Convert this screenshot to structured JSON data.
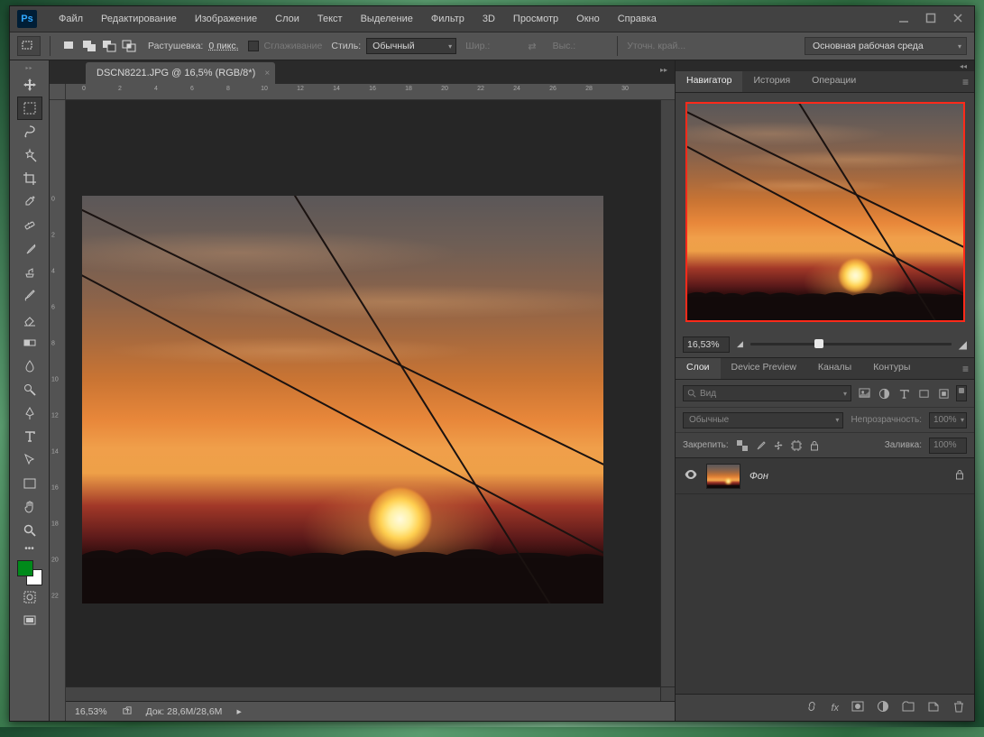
{
  "menuBar": [
    "Файл",
    "Редактирование",
    "Изображение",
    "Слои",
    "Текст",
    "Выделение",
    "Фильтр",
    "3D",
    "Просмотр",
    "Окно",
    "Справка"
  ],
  "optionsBar": {
    "featherLabel": "Растушевка:",
    "featherValue": "0 пикс.",
    "antiAliasLabel": "Сглаживание",
    "styleLabel": "Стиль:",
    "styleValue": "Обычный",
    "widthLabel": "Шир.:",
    "heightLabel": "Выс.:",
    "refineEdge": "Уточн. край...",
    "workspace": "Основная рабочая среда"
  },
  "documentTab": "DSCN8221.JPG @ 16,5% (RGB/8*)",
  "hRuler": [
    "0",
    "2",
    "4",
    "6",
    "8",
    "10",
    "12",
    "14",
    "16",
    "18",
    "20",
    "22",
    "24",
    "26",
    "28",
    "30"
  ],
  "vRuler": [
    "0",
    "2",
    "4",
    "6",
    "8",
    "10",
    "12",
    "14",
    "16",
    "18",
    "20",
    "22"
  ],
  "statusBar": {
    "zoom": "16,53%",
    "docSizeLabel": "Док:",
    "docSize": "28,6M/28,6M"
  },
  "navigator": {
    "tabs": [
      "Навигатор",
      "История",
      "Операции"
    ],
    "zoom": "16,53%"
  },
  "layersPanel": {
    "tabs": [
      "Слои",
      "Device Preview",
      "Каналы",
      "Контуры"
    ],
    "searchPlaceholder": "Вид",
    "blendMode": "Обычные",
    "opacityLabel": "Непрозрачность:",
    "opacityValue": "100%",
    "lockLabel": "Закрепить:",
    "fillLabel": "Заливка:",
    "fillValue": "100%",
    "layers": [
      {
        "name": "Фон",
        "locked": true
      }
    ]
  },
  "footerIcons": [
    "link",
    "fx",
    "mask",
    "adjust",
    "group",
    "new",
    "trash"
  ]
}
